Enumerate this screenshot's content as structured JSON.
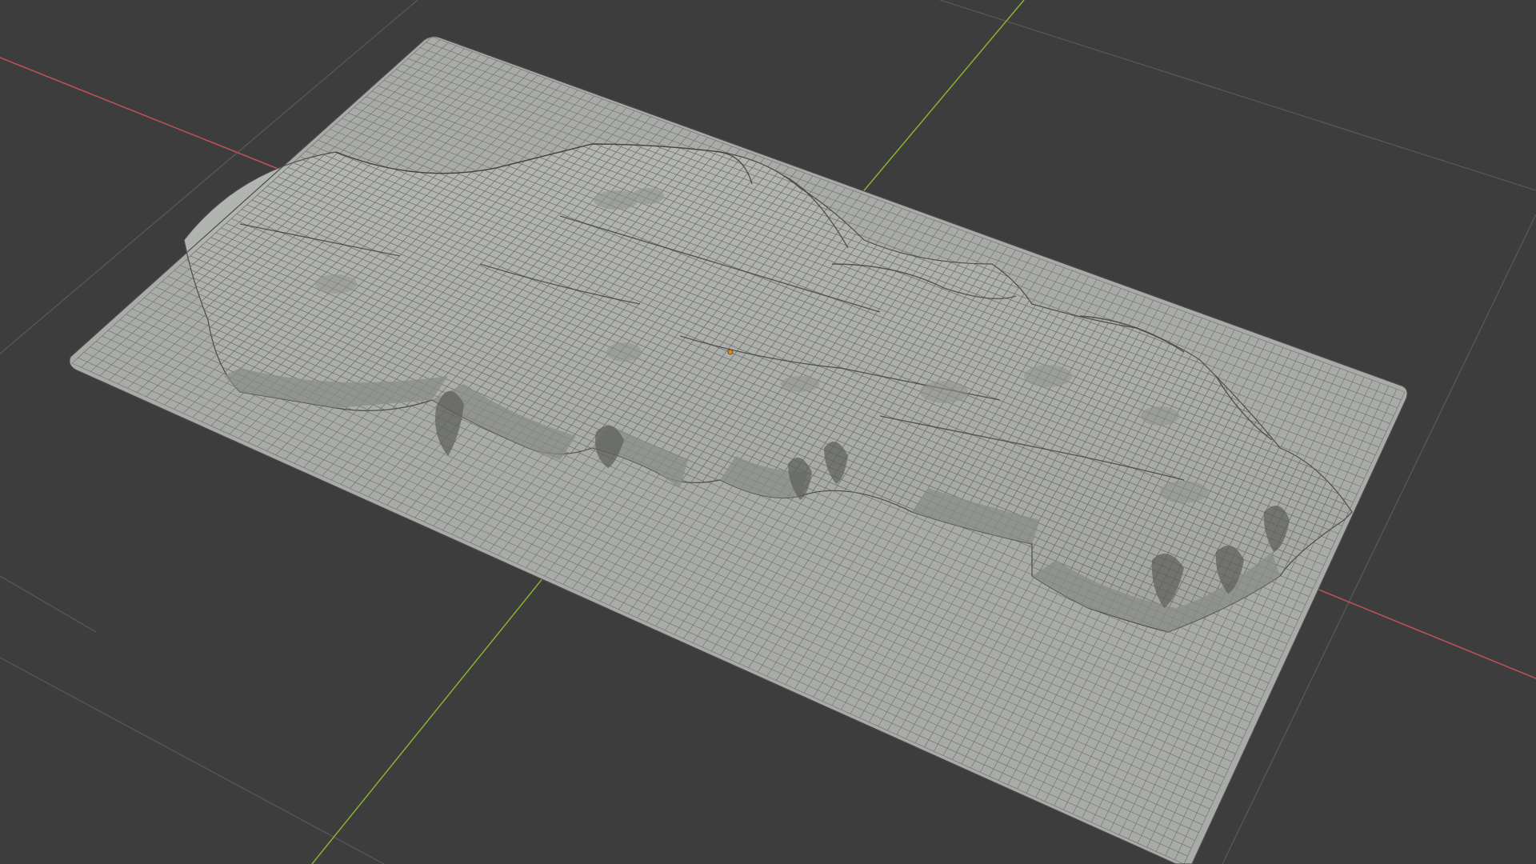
{
  "viewport": {
    "background_color": "#3d3d3d",
    "grid_line_color": "#5a5a5a",
    "x_axis_color": "#c4505a",
    "y_axis_color": "#8bb033",
    "mesh_fill_color": "#a9aba8",
    "mesh_wire_color": "#5f605e",
    "origin_marker_color": "#e08a1a"
  },
  "mesh": {
    "object": "terrain-plane",
    "display": "wireframe-over-solid",
    "feature": "raised-plateau-terrain"
  }
}
